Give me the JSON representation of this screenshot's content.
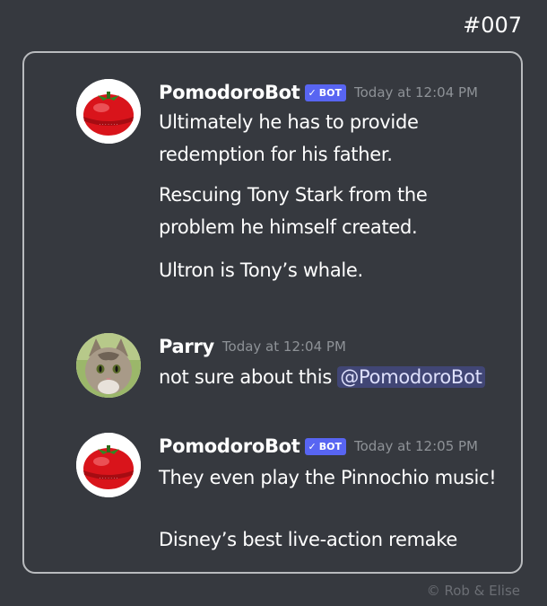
{
  "page_id": "#007",
  "messages": [
    {
      "author": "PomodoroBot",
      "badge": "BOT",
      "badge_check": "✓",
      "timestamp": "Today at 12:04 PM",
      "avatar_icon": "tomato-timer-icon",
      "lines": [
        "Ultimately he has to provide",
        "redemption for his father.",
        "Rescuing Tony Stark from the",
        "problem he himself created.",
        "Ultron is Tony’s whale."
      ]
    },
    {
      "author": "Parry",
      "timestamp": "Today at 12:04 PM",
      "avatar_icon": "cat-icon",
      "text": "not sure about this ",
      "mention": "@PomodoroBot"
    },
    {
      "author": "PomodoroBot",
      "badge": "BOT",
      "badge_check": "✓",
      "timestamp": "Today at 12:05 PM",
      "avatar_icon": "tomato-timer-icon",
      "lines": [
        "They even play the Pinnochio music!",
        "Disney’s best live-action remake"
      ]
    }
  ],
  "watermark": "©   Rob & Elise",
  "colors": {
    "background": "#36393f",
    "badge": "#5865f2",
    "mention_bg": "#414675",
    "timestamp": "#8e9297"
  }
}
